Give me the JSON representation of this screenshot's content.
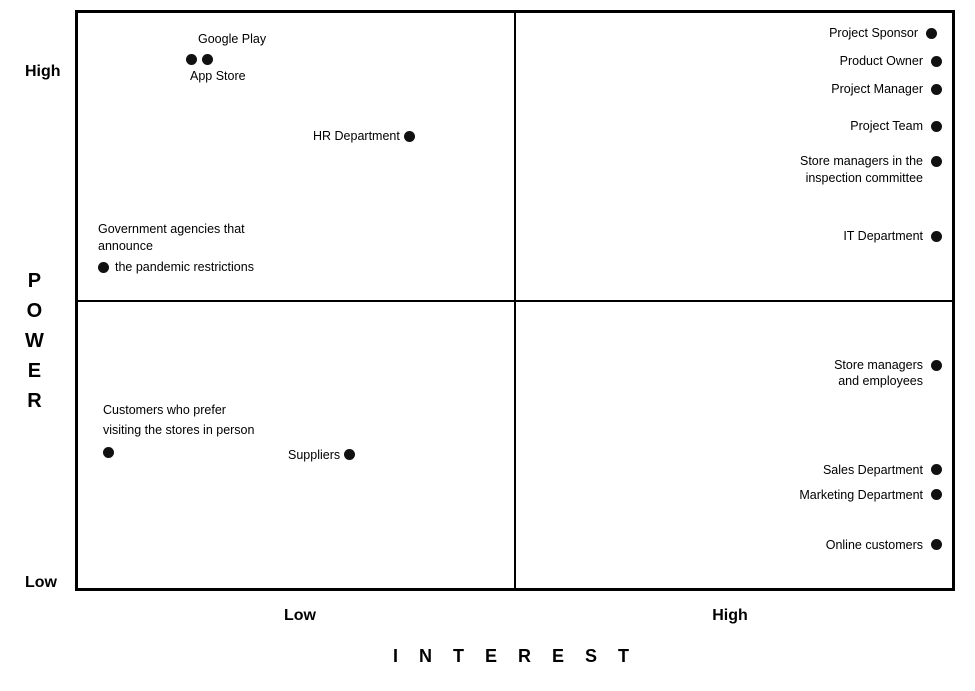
{
  "axis": {
    "x_label": "I N T E R E S T",
    "y_label": [
      "P",
      "O",
      "W",
      "E",
      "R"
    ],
    "x_low": "Low",
    "x_high": "High",
    "y_high": "High",
    "y_low": "Low"
  },
  "stakeholders": {
    "google_play": "Google Play",
    "app_store": "App Store",
    "hr_department": "HR Department",
    "government": "Government agencies that announce\nthe pandemic restrictions",
    "project_sponsor": "Project Sponsor",
    "product_owner": "Product Owner",
    "project_manager": "Project Manager",
    "project_team": "Project Team",
    "store_managers_inspection": "Store managers in the\ninspection committee",
    "it_department": "IT Department",
    "store_managers_employees": "Store managers\nand employees",
    "sales_department": "Sales Department",
    "marketing_department": "Marketing Department",
    "online_customers": "Online customers",
    "customers_instore": "Customers who prefer\nvisiting the stores in person",
    "suppliers": "Suppliers"
  }
}
